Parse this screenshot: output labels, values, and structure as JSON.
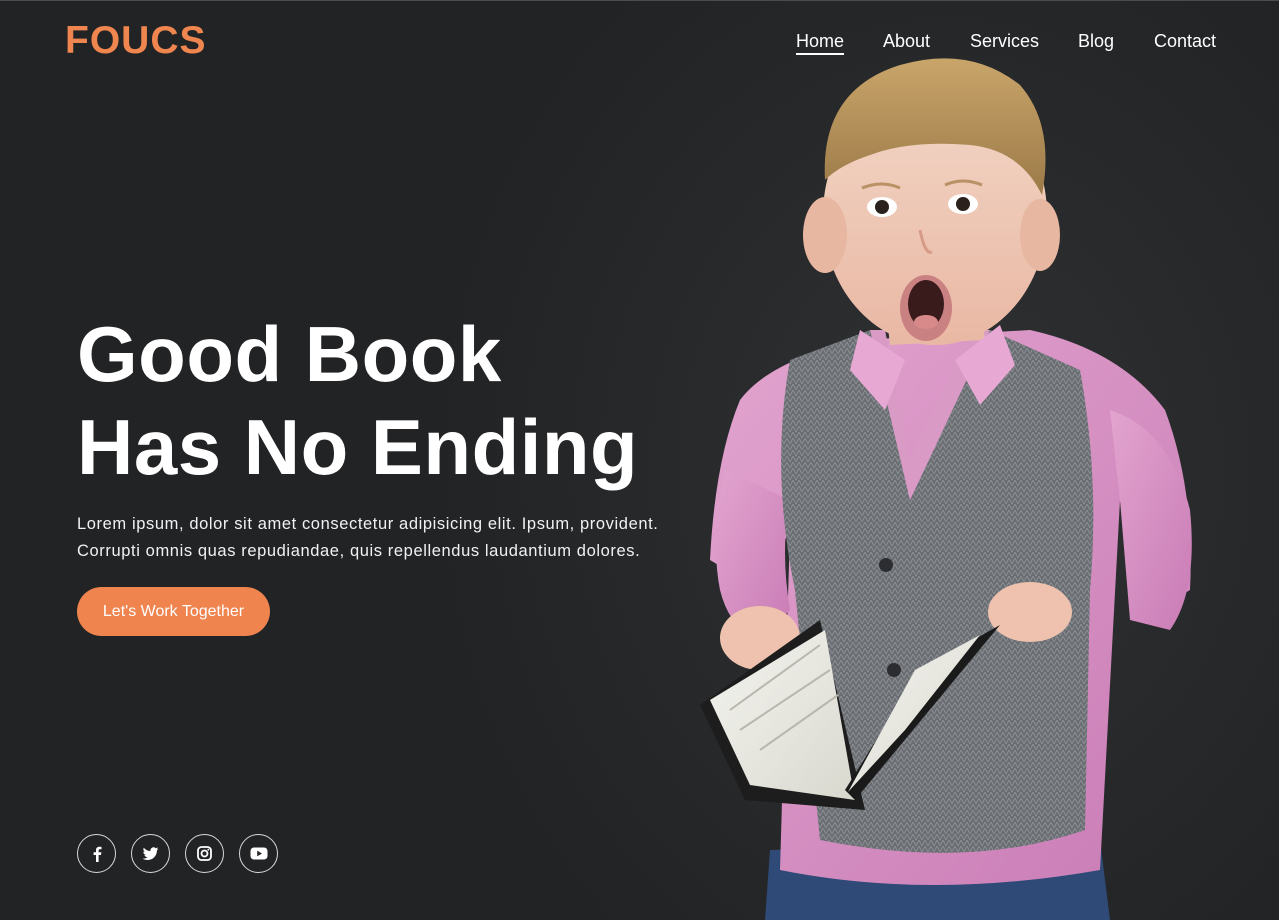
{
  "brand": {
    "logo": "FOUCS",
    "accent_color": "#ef844f"
  },
  "nav": {
    "items": [
      {
        "label": "Home",
        "active": true
      },
      {
        "label": "About",
        "active": false
      },
      {
        "label": "Services",
        "active": false
      },
      {
        "label": "Blog",
        "active": false
      },
      {
        "label": "Contact",
        "active": false
      }
    ]
  },
  "hero": {
    "title_line1": "Good Book",
    "title_line2": "Has No Ending",
    "description_line1": "Lorem ipsum, dolor sit amet consectetur adipisicing elit. Ipsum, provident.",
    "description_line2": "Corrupti omnis quas repudiandae, quis repellendus laudantium dolores.",
    "cta_label": "Let's Work Together"
  },
  "social": {
    "icons": [
      "facebook-icon",
      "twitter-icon",
      "instagram-icon",
      "youtube-icon"
    ]
  }
}
